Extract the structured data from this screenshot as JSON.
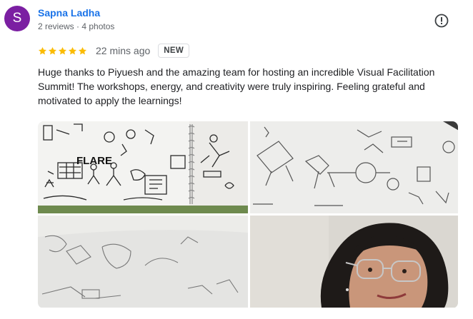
{
  "reviewer": {
    "initial": "S",
    "name": "Sapna Ladha",
    "meta": "2 reviews · 4 photos",
    "avatar_color": "#7b1fa2"
  },
  "review": {
    "rating": 5,
    "time": "22 mins ago",
    "badge": "NEW",
    "text": "Huge thanks to Piyuesh and the amazing team for hosting an incredible Visual Facilitation Summit! The workshops, energy, and creativity were truly inspiring. Feeling grateful and motivated to apply the learnings!",
    "star_color": "#fbbc04"
  },
  "icons": {
    "report": "report-icon",
    "star": "star-icon"
  },
  "photos": [
    {
      "name": "photo-1",
      "description_word": "FLARE"
    },
    {
      "name": "photo-2"
    },
    {
      "name": "photo-3"
    },
    {
      "name": "photo-4"
    }
  ]
}
